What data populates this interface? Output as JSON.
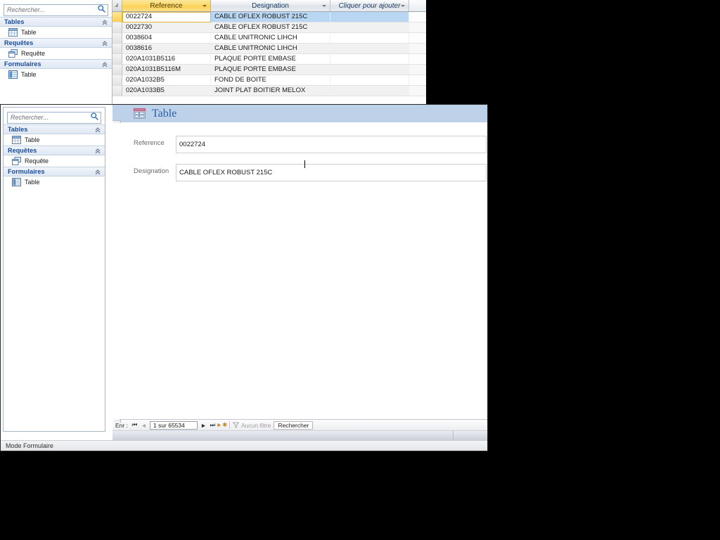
{
  "background_window": {
    "nav_pane": {
      "search": {
        "placeholder": "Rechercher...",
        "value": "",
        "icon": "search-icon"
      },
      "groups": [
        {
          "label": "Tables",
          "collapse_icon": "chevron-up-double-icon",
          "items": [
            {
              "label": "Table",
              "icon": "table-icon"
            }
          ]
        },
        {
          "label": "Requêtes",
          "collapse_icon": "chevron-up-double-icon",
          "items": [
            {
              "label": "Requête",
              "icon": "query-icon"
            }
          ]
        },
        {
          "label": "Formulaires",
          "collapse_icon": "chevron-up-double-icon",
          "items": [
            {
              "label": "Table",
              "icon": "form-icon"
            }
          ]
        }
      ]
    },
    "datasheet": {
      "columns": [
        {
          "label": "Reference",
          "state": "active-sorted",
          "dropdown_icon": "chevron-down-icon"
        },
        {
          "label": "Designation",
          "state": "normal",
          "dropdown_icon": "chevron-down-icon"
        },
        {
          "label": "Cliquer pour ajouter",
          "state": "add-field",
          "dropdown_icon": "chevron-down-icon"
        }
      ],
      "rows": [
        {
          "reference": "0022724",
          "designation": "CABLE OFLEX ROBUST 215C",
          "selected": true
        },
        {
          "reference": "0022730",
          "designation": "CABLE OFLEX ROBUST 215C",
          "selected": false
        },
        {
          "reference": "0038604",
          "designation": "CABLE UNITRONIC LIHCH",
          "selected": false
        },
        {
          "reference": "0038616",
          "designation": "CABLE UNITRONIC LIHCH",
          "selected": false
        },
        {
          "reference": "020A1031B5116",
          "designation": "PLAQUE PORTE EMBASE",
          "selected": false
        },
        {
          "reference": "020A1031B5116M",
          "designation": "PLAQUE PORTE EMBASE",
          "selected": false
        },
        {
          "reference": "020A1032B5",
          "designation": "FOND DE BOITE",
          "selected": false
        },
        {
          "reference": "020A1033B5",
          "designation": "JOINT PLAT BOITIER MELOX",
          "selected": false
        }
      ]
    }
  },
  "foreground_window": {
    "nav_pane": {
      "search": {
        "placeholder": "Rechercher...",
        "value": "",
        "icon": "search-icon"
      },
      "groups": [
        {
          "label": "Tables",
          "collapse_icon": "chevron-up-double-icon",
          "items": [
            {
              "label": "Table",
              "icon": "table-icon"
            }
          ]
        },
        {
          "label": "Requêtes",
          "collapse_icon": "chevron-up-double-icon",
          "items": [
            {
              "label": "Requête",
              "icon": "query-icon"
            }
          ]
        },
        {
          "label": "Formulaires",
          "collapse_icon": "chevron-up-double-icon",
          "items": [
            {
              "label": "Table",
              "icon": "form-icon"
            }
          ]
        }
      ]
    },
    "form": {
      "header": {
        "title": "Table",
        "icon": "form-view-icon"
      },
      "record_selector_icon": "record-arrow-icon",
      "fields": [
        {
          "label": "Reference",
          "value": "0022724",
          "focused": true
        },
        {
          "label": "Designation",
          "value": "CABLE OFLEX ROBUST 215C",
          "focused": false
        }
      ]
    },
    "record_navigator": {
      "prefix": "Enr :",
      "first_icon": "nav-first-icon",
      "prev_icon": "nav-prev-icon",
      "position": "1 sur 65534",
      "next_icon": "nav-next-icon",
      "last_icon": "nav-last-icon",
      "new_icon": "nav-new-record-icon",
      "filter_icon": "filter-icon",
      "filter_label": "Aucun filtre",
      "search_label": "Rechercher"
    },
    "status_bar": {
      "text": "Mode Formulaire"
    }
  },
  "colors": {
    "accent_blue": "#2a5fa8",
    "form_header_band": "#bdd1e8",
    "active_column_gold": "#fbd052",
    "selected_row_blue": "#b9d6f2",
    "group_label_blue": "#16499b",
    "desktop_black": "#000000"
  }
}
